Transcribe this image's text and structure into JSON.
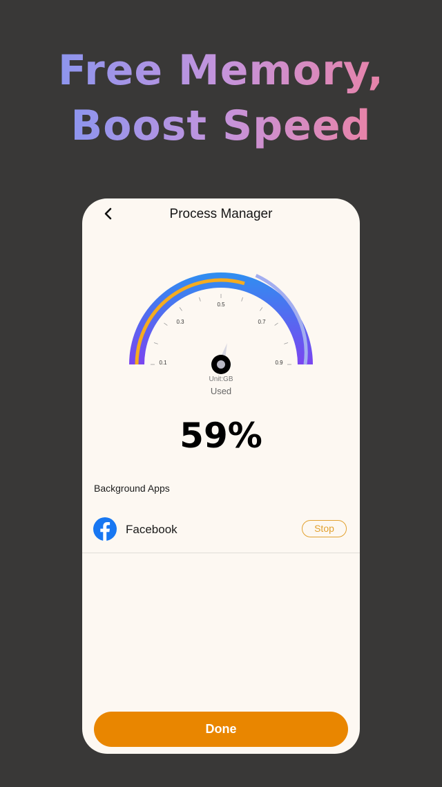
{
  "headline": {
    "line1": "Free Memory,",
    "line2": "Boost Speed"
  },
  "screen": {
    "back_icon": "chevron-left-icon",
    "title": "Process Manager",
    "gauge": {
      "tick_labels": [
        "0.1",
        "0.3",
        "0.5",
        "0.7",
        "0.9"
      ],
      "unit_label": "Unit:GB",
      "used_label": "Used",
      "usage_fraction": 0.59,
      "colors": {
        "arc_start": "#7a45f0",
        "arc_end": "#2f8ff0",
        "progress": "#f5ac20",
        "inner_light": "#a3aef0"
      }
    },
    "percent": "59%",
    "section_label": "Background Apps",
    "apps": [
      {
        "name": "Facebook",
        "icon": "facebook-icon",
        "stop_label": "Stop"
      }
    ],
    "done_label": "Done"
  },
  "colors": {
    "background": "#393837",
    "card": "#fdf8f2",
    "accent": "#e98600",
    "stop": "#e2a12f"
  }
}
